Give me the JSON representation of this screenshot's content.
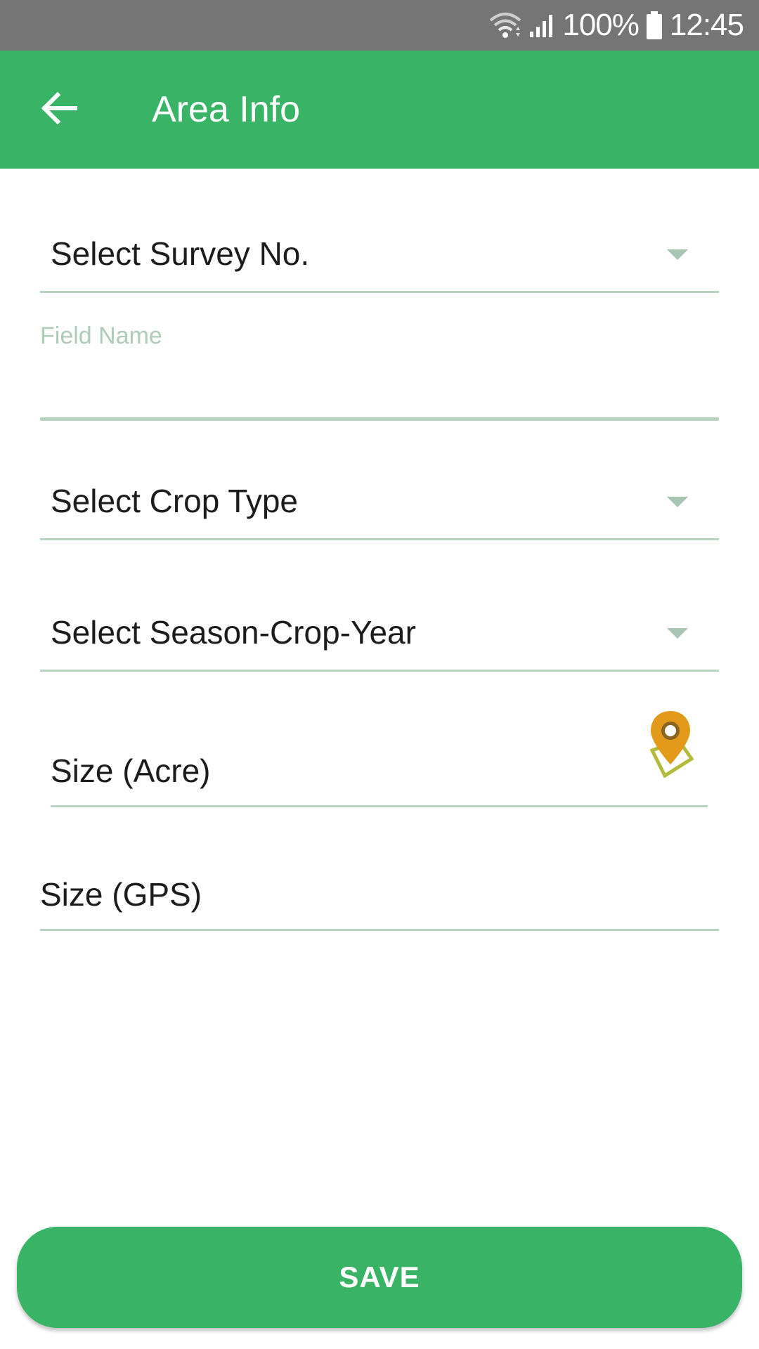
{
  "status_bar": {
    "battery": "100%",
    "time": "12:45",
    "icons": [
      "wifi-icon",
      "signal-icon",
      "battery-icon"
    ]
  },
  "app_bar": {
    "title": "Area Info",
    "back_icon": "arrow-left-icon",
    "color": "#39b466"
  },
  "form": {
    "survey_select": {
      "value": "Select Survey No."
    },
    "field_name": {
      "label": "Field Name",
      "value": ""
    },
    "crop_type_select": {
      "value": "Select Crop Type"
    },
    "season_select": {
      "value": "Select Season-Crop-Year"
    },
    "size_acre": {
      "placeholder": "Size (Acre)",
      "icon": "map-pin-icon"
    },
    "size_gps": {
      "placeholder": "Size (GPS)"
    }
  },
  "save_button": {
    "label": "SAVE"
  },
  "colors": {
    "accent": "#39b466",
    "status_bar": "#757575",
    "underline": "#b8d3c1",
    "pin": "#e39a1b",
    "pin_outline": "#b3bb3a"
  }
}
